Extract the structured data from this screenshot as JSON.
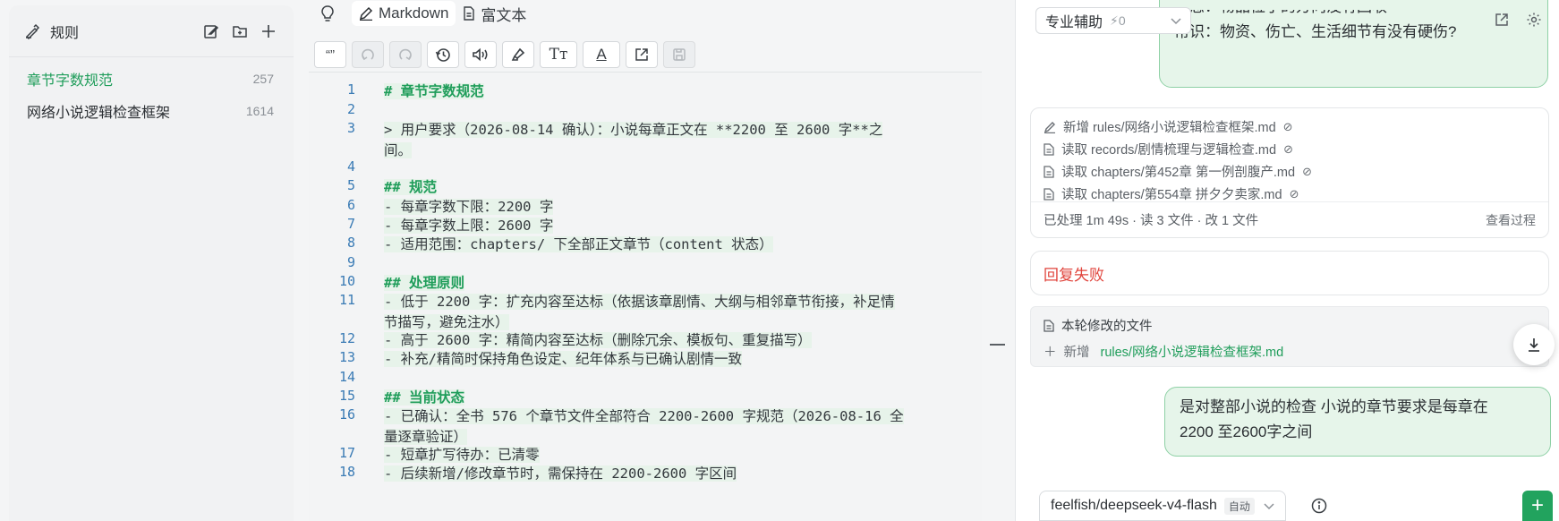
{
  "sidebar": {
    "title": "规则",
    "items": [
      {
        "name": "章节字数规范",
        "count": "257"
      },
      {
        "name": "网络小说逻辑检查框架",
        "count": "1614"
      }
    ]
  },
  "editor": {
    "tabs": [
      {
        "label": "Markdown"
      },
      {
        "label": "富文本"
      }
    ],
    "toolbar": {
      "quote": "“”",
      "text_size": "Tт",
      "font_color": "A"
    },
    "lines": [
      {
        "n": "1",
        "t": "# 章节字数规范"
      },
      {
        "n": "2",
        "t": ""
      },
      {
        "n": "3a",
        "t": "> 用户要求（2026-08-14 确认）：小说每章正文在 **2200 至 2600 字**之"
      },
      {
        "n": "3b",
        "t": "间。"
      },
      {
        "n": "4",
        "t": ""
      },
      {
        "n": "5",
        "t": "## 规范"
      },
      {
        "n": "6",
        "t": "- 每章字数下限：2200 字"
      },
      {
        "n": "7",
        "t": "- 每章字数上限：2600 字"
      },
      {
        "n": "8",
        "t": "- 适用范围：chapters/ 下全部正文章节（content 状态）"
      },
      {
        "n": "9",
        "t": ""
      },
      {
        "n": "10",
        "t": "## 处理原则"
      },
      {
        "n": "11a",
        "t": "- 低于 2200 字：扩充内容至达标（依据该章剧情、大纲与相邻章节衔接，补足情"
      },
      {
        "n": "11b",
        "t": "节描写，避免注水）"
      },
      {
        "n": "12",
        "t": "- 高于 2600 字：精简内容至达标（删除冗余、模板句、重复描写）"
      },
      {
        "n": "13",
        "t": "- 补充/精简时保持角色设定、纪年体系与已确认剧情一致"
      },
      {
        "n": "14",
        "t": ""
      },
      {
        "n": "15",
        "t": "## 当前状态"
      },
      {
        "n": "16a",
        "t": "- 已确认：全书 576 个章节文件全部符合 2200-2600 字规范（2026-08-16 全"
      },
      {
        "n": "16b",
        "t": "量逐章验证）"
      },
      {
        "n": "17",
        "t": "- 短章扩写待办：已清零"
      },
      {
        "n": "18",
        "t": "- 后续新增/修改章节时，需保持在 2200-2600 字区间"
      }
    ]
  },
  "right": {
    "assist_label": "专业辅助",
    "assist_count": "0",
    "top_bubble": {
      "cut_line": "状态：物品位于的方向没有回收",
      "line": "常识：物资、伤亡、生活细节有没有硬伤?"
    },
    "tools": [
      {
        "icon": "edit-icon",
        "text": "新增 rules/网络小说逻辑检查框架.md"
      },
      {
        "icon": "file-icon",
        "text": "读取 records/剧情梳理与逻辑检查.md"
      },
      {
        "icon": "file-icon",
        "text": "读取 chapters/第452章 第一例剖腹产.md"
      },
      {
        "icon": "file-icon",
        "text": "读取 chapters/第554章 拼夕夕卖家.md"
      }
    ],
    "tools_summary": "已处理 1m 49s · 读 3 文件 · 改 1 文件",
    "view_process": "查看过程",
    "error_text": "回复失败",
    "files_title": "本轮修改的文件",
    "files_row_label": "新增",
    "files_row_path": "rules/网络小说逻辑检查框架.md",
    "user_message_line1": "是对整部小说的检查 小说的章节要求是每章在",
    "user_message_line2": "2200 至2600字之间",
    "model": "feelfish/deepseek-v4-flash",
    "model_mode": "自动"
  }
}
